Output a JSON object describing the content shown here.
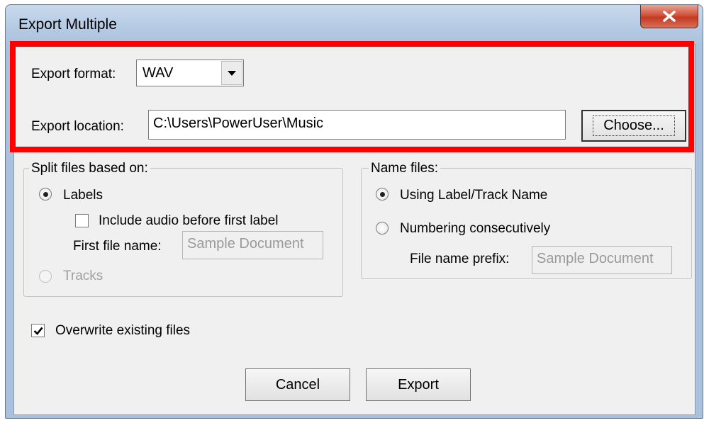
{
  "window": {
    "title": "Export Multiple"
  },
  "export": {
    "format_label": "Export format:",
    "format_value": "WAV",
    "location_label": "Export location:",
    "location_value": "C:\\Users\\PowerUser\\Music",
    "choose_label": "Choose..."
  },
  "split": {
    "title": "Split files based on:",
    "labels_option": "Labels",
    "include_audio": "Include audio before first label",
    "first_file_label": "First file name:",
    "first_file_value": "Sample Document",
    "tracks_option": "Tracks"
  },
  "name": {
    "title": "Name files:",
    "using_label": "Using Label/Track Name",
    "numbering": "Numbering consecutively",
    "prefix_label": "File name prefix:",
    "prefix_value": "Sample Document"
  },
  "overwrite": {
    "label": "Overwrite existing files",
    "checked": true
  },
  "buttons": {
    "cancel": "Cancel",
    "export": "Export"
  },
  "colors": {
    "highlight": "#ff0000",
    "close": "#c23a22"
  }
}
